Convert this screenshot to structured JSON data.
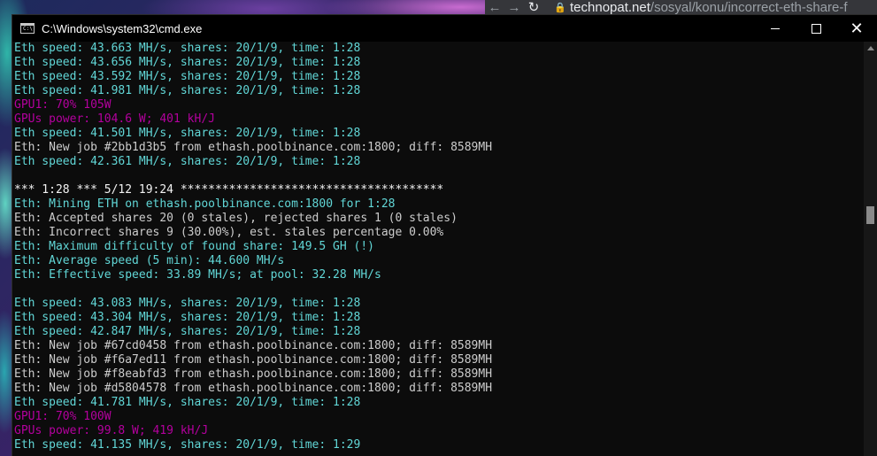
{
  "browser": {
    "back_glyph": "←",
    "forward_glyph": "→",
    "reload_glyph": "↻",
    "lock_glyph": "🔒",
    "url_host": "technopat.net",
    "url_path": "/sosyal/konu/incorrect-eth-share-f"
  },
  "window": {
    "title": "C:\\Windows\\system32\\cmd.exe",
    "icon_text": "C:\\",
    "minimize_icon": "minimize-icon",
    "maximize_icon": "maximize-icon",
    "close_glyph": "✕"
  },
  "colors": {
    "cyan": "#61d6d6",
    "gray": "#cccccc",
    "magenta": "#b4009e",
    "white": "#f2f2f2",
    "console_bg": "#0c0c0c"
  },
  "console": {
    "lines": [
      {
        "text": "Eth speed: 43.663 MH/s, shares: 20/1/9, time: 1:28",
        "color": "cyan"
      },
      {
        "text": "Eth speed: 43.656 MH/s, shares: 20/1/9, time: 1:28",
        "color": "cyan"
      },
      {
        "text": "Eth speed: 43.592 MH/s, shares: 20/1/9, time: 1:28",
        "color": "cyan"
      },
      {
        "text": "Eth speed: 41.981 MH/s, shares: 20/1/9, time: 1:28",
        "color": "cyan"
      },
      {
        "text": "GPU1: 70% 105W",
        "color": "magenta"
      },
      {
        "text": "GPUs power: 104.6 W; 401 kH/J",
        "color": "magenta"
      },
      {
        "text": "Eth speed: 41.501 MH/s, shares: 20/1/9, time: 1:28",
        "color": "cyan"
      },
      {
        "text": "Eth: New job #2bb1d3b5 from ethash.poolbinance.com:1800; diff: 8589MH",
        "color": "gray"
      },
      {
        "text": "Eth speed: 42.361 MH/s, shares: 20/1/9, time: 1:28",
        "color": "cyan"
      },
      {
        "text": "",
        "color": "gray"
      },
      {
        "text": "*** 1:28 *** 5/12 19:24 **************************************",
        "color": "white"
      },
      {
        "text": "Eth: Mining ETH on ethash.poolbinance.com:1800 for 1:28",
        "color": "cyan"
      },
      {
        "text": "Eth: Accepted shares 20 (0 stales), rejected shares 1 (0 stales)",
        "color": "gray"
      },
      {
        "text": "Eth: Incorrect shares 9 (30.00%), est. stales percentage 0.00%",
        "color": "gray"
      },
      {
        "text": "Eth: Maximum difficulty of found share: 149.5 GH (!)",
        "color": "cyan"
      },
      {
        "text": "Eth: Average speed (5 min): 44.600 MH/s",
        "color": "cyan"
      },
      {
        "text": "Eth: Effective speed: 33.89 MH/s; at pool: 32.28 MH/s",
        "color": "cyan"
      },
      {
        "text": "",
        "color": "gray"
      },
      {
        "text": "Eth speed: 43.083 MH/s, shares: 20/1/9, time: 1:28",
        "color": "cyan"
      },
      {
        "text": "Eth speed: 43.304 MH/s, shares: 20/1/9, time: 1:28",
        "color": "cyan"
      },
      {
        "text": "Eth speed: 42.847 MH/s, shares: 20/1/9, time: 1:28",
        "color": "cyan"
      },
      {
        "text": "Eth: New job #67cd0458 from ethash.poolbinance.com:1800; diff: 8589MH",
        "color": "gray"
      },
      {
        "text": "Eth: New job #f6a7ed11 from ethash.poolbinance.com:1800; diff: 8589MH",
        "color": "gray"
      },
      {
        "text": "Eth: New job #f8eabfd3 from ethash.poolbinance.com:1800; diff: 8589MH",
        "color": "gray"
      },
      {
        "text": "Eth: New job #d5804578 from ethash.poolbinance.com:1800; diff: 8589MH",
        "color": "gray"
      },
      {
        "text": "Eth speed: 41.781 MH/s, shares: 20/1/9, time: 1:28",
        "color": "cyan"
      },
      {
        "text": "GPU1: 70% 100W",
        "color": "magenta"
      },
      {
        "text": "GPUs power: 99.8 W; 419 kH/J",
        "color": "magenta"
      },
      {
        "text": "Eth speed: 41.135 MH/s, shares: 20/1/9, time: 1:29",
        "color": "cyan"
      }
    ]
  }
}
